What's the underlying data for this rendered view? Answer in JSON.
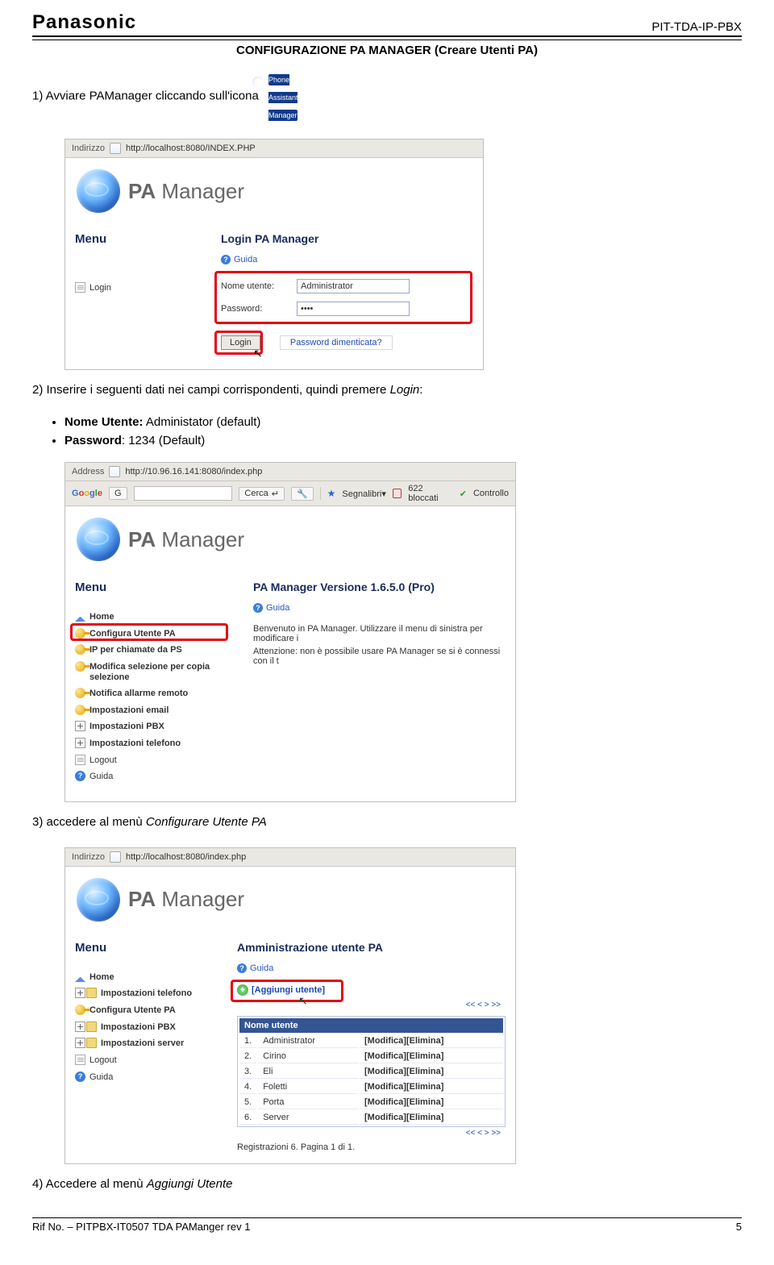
{
  "header": {
    "brand": "Panasonic",
    "code": "PIT-TDA-IP-PBX",
    "section_title": "CONFIGURAZIONE PA MANAGER (Creare Utenti PA)"
  },
  "step1": {
    "text_pre": "1)   Avviare PAManager cliccando sull'icona",
    "icon_caption": "Phone Assistant Manager"
  },
  "shot1": {
    "addr_label": "Indirizzo",
    "addr_url": "http://localhost:8080/INDEX.PHP",
    "banner": "PA Manager",
    "menu_title": "Menu",
    "menu_login": "Login",
    "box_title": "Login PA Manager",
    "guida": "Guida",
    "field_user_label": "Nome utente:",
    "field_user_value": "Administrator",
    "field_pass_label": "Password:",
    "field_pass_value": "••••",
    "btn_login": "Login",
    "forgot": "Password dimenticata?"
  },
  "step2": {
    "intro": "2)   Inserire i seguenti dati nei campi corrispondenti, quindi premere ",
    "intro_em": "Login",
    "bullet1_label": "Nome Utente:",
    "bullet1_val": " Administator (default)",
    "bullet2_label": "Password",
    "bullet2_val": ": 1234 (Default)"
  },
  "shot2": {
    "addr_label": "Address",
    "addr_url": "http://10.96.16.141:8080/index.php",
    "google": "Google",
    "gbtn": "G",
    "cerca": "Cerca",
    "segnalibri": "Segnalibri",
    "bloccati": "622 bloccati",
    "controllo": "Controllo",
    "banner": "PA Manager",
    "menu_title": "Menu",
    "menu_items": [
      "Home",
      "Configura Utente PA",
      "IP per chiamate da PS",
      "Modifica selezione per copia selezione",
      "Notifica allarme remoto",
      "Impostazioni email",
      "Impostazioni PBX",
      "Impostazioni telefono",
      "Logout",
      "Guida"
    ],
    "box_title": "PA Manager Versione 1.6.5.0 (Pro)",
    "guida": "Guida",
    "line1": "Benvenuto in PA Manager. Utilizzare il menu di sinistra per modificare i",
    "line2": "Attenzione: non è possibile usare PA Manager se si è connessi con il t"
  },
  "step3": {
    "text_pre": "3)   accedere al menù ",
    "text_em": "Configurare Utente PA"
  },
  "shot3": {
    "addr_label": "Indirizzo",
    "addr_url": "http://localhost:8080/index.php",
    "banner": "PA Manager",
    "menu_title": "Menu",
    "menu_items": [
      "Home",
      "Impostazioni telefono",
      "Configura Utente PA",
      "Impostazioni PBX",
      "Impostazioni server",
      "Logout",
      "Guida"
    ],
    "box_title": "Amministrazione utente PA",
    "guida": "Guida",
    "add_user": "[Aggiungi utente]",
    "pager": "<< < > >>",
    "th": "Nome utente",
    "rows": [
      {
        "n": "1.",
        "name": "Administrator",
        "act": "[Modifica][Elimina]"
      },
      {
        "n": "2.",
        "name": "Cirino",
        "act": "[Modifica][Elimina]"
      },
      {
        "n": "3.",
        "name": "Eli",
        "act": "[Modifica][Elimina]"
      },
      {
        "n": "4.",
        "name": "Foletti",
        "act": "[Modifica][Elimina]"
      },
      {
        "n": "5.",
        "name": "Porta",
        "act": "[Modifica][Elimina]"
      },
      {
        "n": "6.",
        "name": "Server",
        "act": "[Modifica][Elimina]"
      }
    ],
    "pager2": "<< < > >>",
    "reg": "Registrazioni 6. Pagina 1 di 1."
  },
  "step4": {
    "text_pre": "4)   Accedere al menù ",
    "text_em": "Aggiungi Utente"
  },
  "footer": {
    "ref": "Rif No. – PITPBX-IT0507 TDA PAManger rev 1",
    "page": "5"
  }
}
